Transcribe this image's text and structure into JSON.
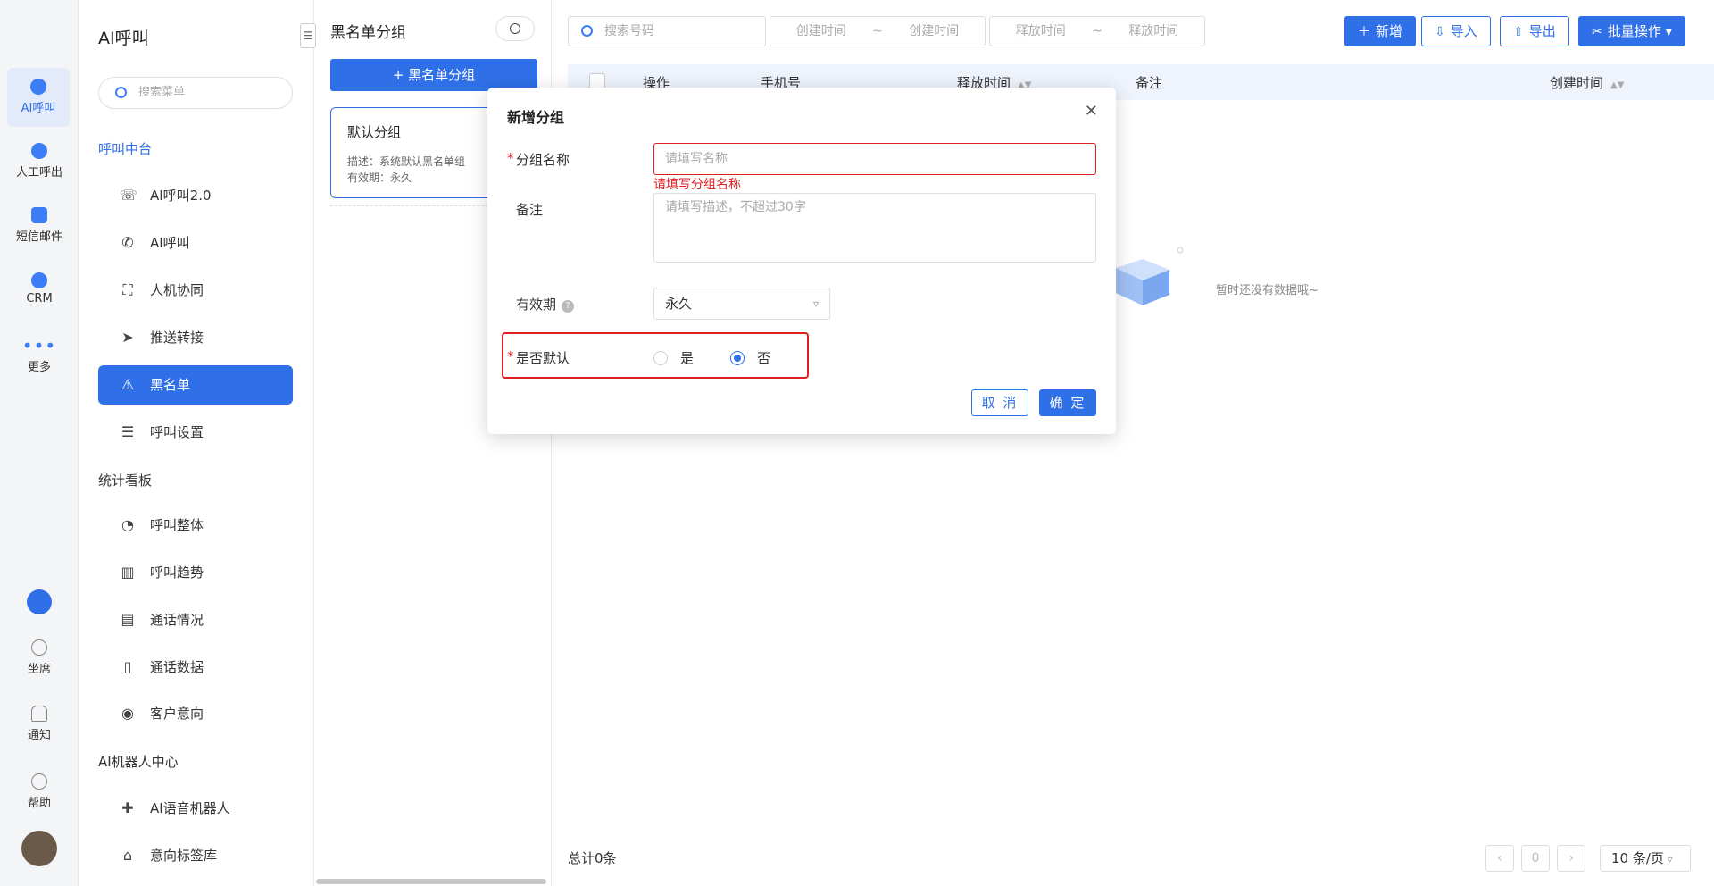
{
  "rail": {
    "items": [
      {
        "label": "AI呼叫",
        "icon": "robot-icon",
        "active": true
      },
      {
        "label": "人工呼出",
        "icon": "person-icon"
      },
      {
        "label": "短信邮件",
        "icon": "message-icon"
      },
      {
        "label": "CRM",
        "icon": "crm-icon"
      },
      {
        "label": "更多",
        "icon": "more-icon"
      }
    ],
    "bottom": [
      {
        "label": "坐席",
        "icon": "headset-icon"
      },
      {
        "label": "通知",
        "icon": "bell-icon"
      },
      {
        "label": "帮助",
        "icon": "help-icon"
      }
    ]
  },
  "menu": {
    "title": "AI呼叫",
    "search_placeholder": "搜索菜单",
    "sections": [
      {
        "title": "呼叫中台",
        "items": [
          "AI呼叫2.0",
          "AI呼叫",
          "人机协同",
          "推送转接",
          "黑名单",
          "呼叫设置"
        ]
      },
      {
        "title": "统计看板",
        "items": [
          "呼叫整体",
          "呼叫趋势",
          "通话情况",
          "通话数据",
          "客户意向"
        ]
      },
      {
        "title": "AI机器人中心",
        "items": [
          "AI语音机器人",
          "意向标签库"
        ]
      }
    ]
  },
  "groups": {
    "title": "黑名单分组",
    "add_button": "+ 黑名单分组",
    "card": {
      "name": "默认分组",
      "desc": "描述：系统默认黑名单组",
      "validity": "有效期：永久"
    }
  },
  "toolbar": {
    "search_placeholder": "搜索号码",
    "create_start": "创建时间",
    "create_end": "创建时间",
    "release_start": "释放时间",
    "release_end": "释放时间",
    "tilde": "~",
    "add": "新增",
    "import": "导入",
    "export": "导出",
    "batch": "批量操作"
  },
  "table": {
    "headers": [
      "操作",
      "手机号",
      "释放时间",
      "备注",
      "创建时间"
    ],
    "empty_text": "暂时还没有数据哦~",
    "total": "总计0条",
    "page": "0",
    "page_size": "10 条/页"
  },
  "modal": {
    "title": "新增分组",
    "name_label": "分组名称",
    "name_placeholder": "请填写名称",
    "name_error": "请填写分组名称",
    "remark_label": "备注",
    "remark_placeholder": "请填写描述，不超过30字",
    "validity_label": "有效期",
    "validity_value": "永久",
    "default_label": "是否默认",
    "yes": "是",
    "no": "否",
    "cancel": "取 消",
    "ok": "确 定",
    "required_mark": "*"
  },
  "colors": {
    "accent": "#2f6fe8",
    "error": "#e02020"
  }
}
